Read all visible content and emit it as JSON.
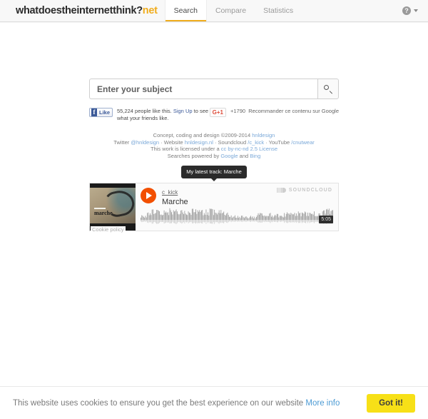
{
  "header": {
    "brand_main": "whatdoestheinternetthink?",
    "brand_suffix": "net",
    "nav": [
      {
        "label": "Search",
        "active": true
      },
      {
        "label": "Compare",
        "active": false
      },
      {
        "label": "Statistics",
        "active": false
      }
    ],
    "help_glyph": "?"
  },
  "search": {
    "placeholder": "Enter your subject",
    "value": "",
    "button_icon": "search-icon"
  },
  "social": {
    "facebook": {
      "like_label": "Like",
      "f_glyph": "f",
      "count_text": "55,224 people like this.",
      "signup_text": "Sign Up",
      "tail_text": " to see what your friends like."
    },
    "google": {
      "button_label": "G+1",
      "count": "+1790",
      "description": "Recommander ce contenu sur Google"
    }
  },
  "credits": {
    "line1_prefix": "Concept, coding and design ©2009-2014 ",
    "line1_link": "hnldesign",
    "line2": [
      {
        "text": "Twitter ",
        "link": false
      },
      {
        "text": "@hnldesign",
        "link": true
      },
      {
        "text": " · Website ",
        "link": false
      },
      {
        "text": "hnldesign.nl",
        "link": true
      },
      {
        "text": " · Soundcloud ",
        "link": false
      },
      {
        "text": "/c_kick",
        "link": true
      },
      {
        "text": " · YouTube ",
        "link": false
      },
      {
        "text": "/cnutwear",
        "link": true
      }
    ],
    "line3_prefix": "This work is licensed under a ",
    "line3_link": "cc by-nc-nd 2.5 License",
    "line4_prefix": "Searches powered by ",
    "line4_link1": "Google",
    "line4_middle": " and ",
    "line4_link2": "Bing"
  },
  "tooltip": {
    "text": "My latest track: Marche"
  },
  "soundcloud": {
    "artwork_label": "marche",
    "user": "c_kick",
    "title": "Marche",
    "logo_text": "SOUNDCLOUD",
    "duration": "5:05",
    "cookie_policy": "Cookie policy"
  },
  "cookie_banner": {
    "message": "This website uses cookies to ensure you get the best experience on our website ",
    "more_info": "More info",
    "accept_label": "Got it!",
    "accept_color": "#f7e017"
  }
}
